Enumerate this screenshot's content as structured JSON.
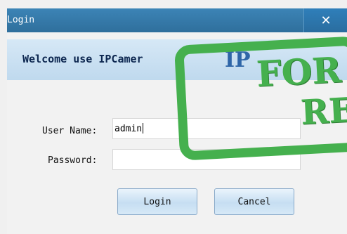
{
  "window": {
    "title": "Login",
    "close_glyph": "✕"
  },
  "banner": {
    "welcome_text": "Welcome use IPCamer",
    "behind_stamp_text": "IP"
  },
  "form": {
    "username_label": "User Name:",
    "username_value": "admin",
    "password_label": "Password:",
    "password_value": ""
  },
  "buttons": {
    "login_label": "Login",
    "cancel_label": "Cancel"
  },
  "stamp": {
    "line1": "FOR",
    "line2": "RE",
    "color": "#45b04e"
  },
  "colors": {
    "titlebar": "#3c84b6",
    "banner": "#c9e0f2",
    "text_dark": "#0d2750"
  }
}
